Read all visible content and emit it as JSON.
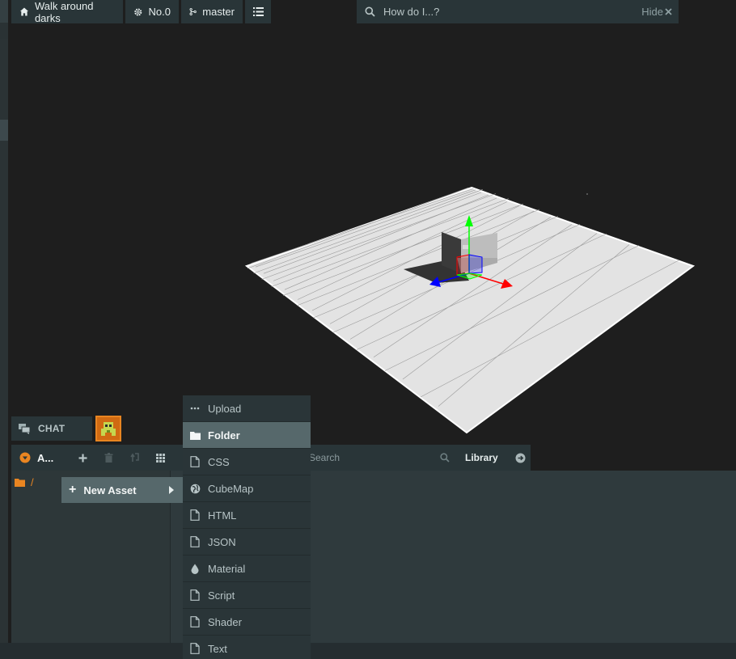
{
  "toolbar": {
    "project_name": "Walk around darks",
    "settings_label": "No.0",
    "branch_label": "master"
  },
  "help_search": {
    "query": "How do I...?",
    "hide_label": "Hide"
  },
  "chat": {
    "label": "CHAT"
  },
  "assets": {
    "title": "A...",
    "search_placeholder": "Search",
    "library_label": "Library",
    "root_folder": "/"
  },
  "new_asset": {
    "label": "New Asset"
  },
  "new_asset_menu": {
    "items": [
      {
        "label": "Upload",
        "icon": "more-icon"
      },
      {
        "label": "Folder",
        "icon": "folder-icon"
      },
      {
        "label": "CSS",
        "icon": "file-icon"
      },
      {
        "label": "CubeMap",
        "icon": "globe-icon"
      },
      {
        "label": "HTML",
        "icon": "file-icon"
      },
      {
        "label": "JSON",
        "icon": "file-icon"
      },
      {
        "label": "Material",
        "icon": "drop-icon"
      },
      {
        "label": "Script",
        "icon": "file-icon"
      },
      {
        "label": "Shader",
        "icon": "file-icon"
      },
      {
        "label": "Text",
        "icon": "file-icon"
      }
    ],
    "active": "Folder"
  },
  "colors": {
    "panel": "#293538",
    "highlight": "#56686b",
    "accent": "#e98521",
    "viewport_bg": "#1e1e1e",
    "gizmo_x": "#ff0000",
    "gizmo_y": "#00ff00",
    "gizmo_z": "#0000ff"
  }
}
